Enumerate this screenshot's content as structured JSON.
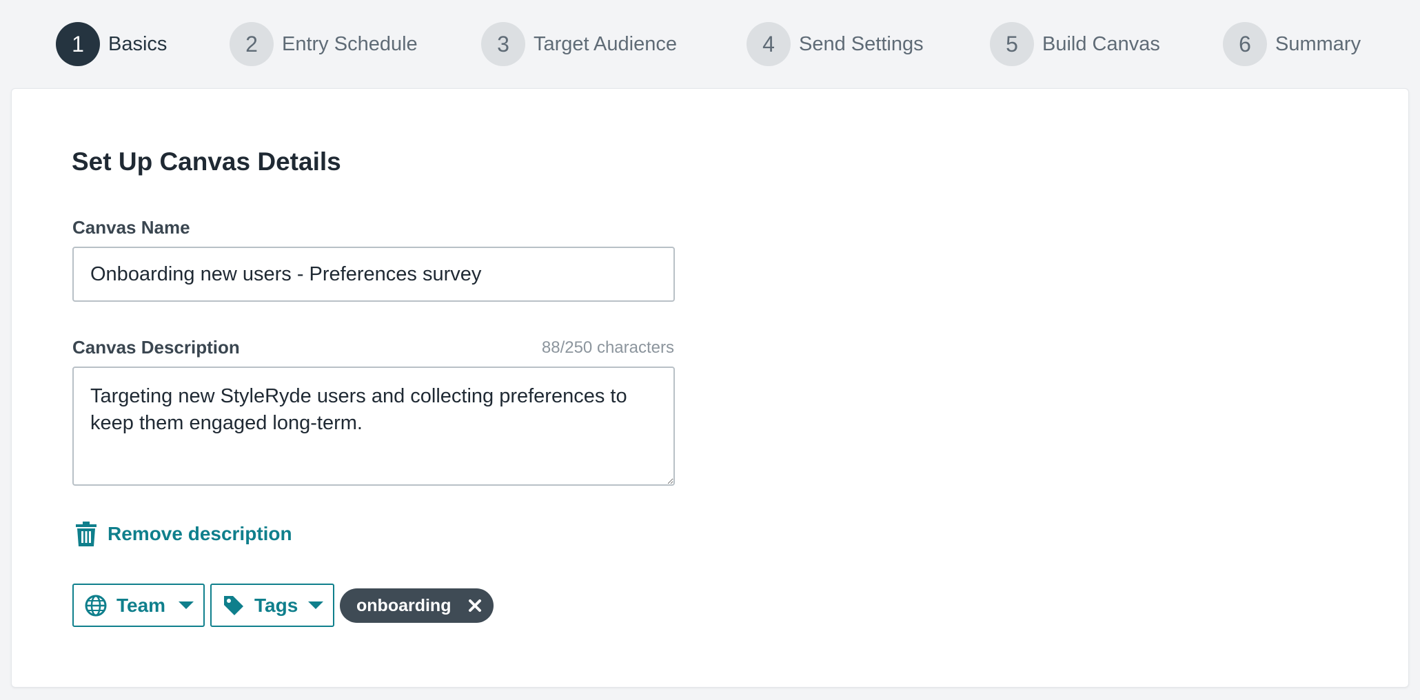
{
  "stepper": {
    "steps": [
      {
        "number": "1",
        "label": "Basics",
        "active": true
      },
      {
        "number": "2",
        "label": "Entry Schedule",
        "active": false
      },
      {
        "number": "3",
        "label": "Target Audience",
        "active": false
      },
      {
        "number": "4",
        "label": "Send Settings",
        "active": false
      },
      {
        "number": "5",
        "label": "Build Canvas",
        "active": false
      },
      {
        "number": "6",
        "label": "Summary",
        "active": false
      }
    ]
  },
  "form": {
    "title": "Set Up Canvas Details",
    "name_label": "Canvas Name",
    "name_value": "Onboarding new users - Preferences survey",
    "description_label": "Canvas Description",
    "description_count": "88/250 characters",
    "description_value": "Targeting new StyleRyde users and collecting preferences to keep them engaged long-term.",
    "remove_description_label": "Remove description",
    "team_label": "Team",
    "tags_label": "Tags",
    "tags": [
      "onboarding"
    ]
  },
  "icons": {
    "trash": "trash-icon",
    "globe": "globe-icon",
    "tag": "tag-icon",
    "caret": "caret-down-icon",
    "close": "close-icon"
  },
  "colors": {
    "accent": "#0f7f8c",
    "active_step": "#253440",
    "inactive_step": "#dcdfe2",
    "tag_pill": "#3f4b55",
    "background": "#f3f4f6"
  }
}
